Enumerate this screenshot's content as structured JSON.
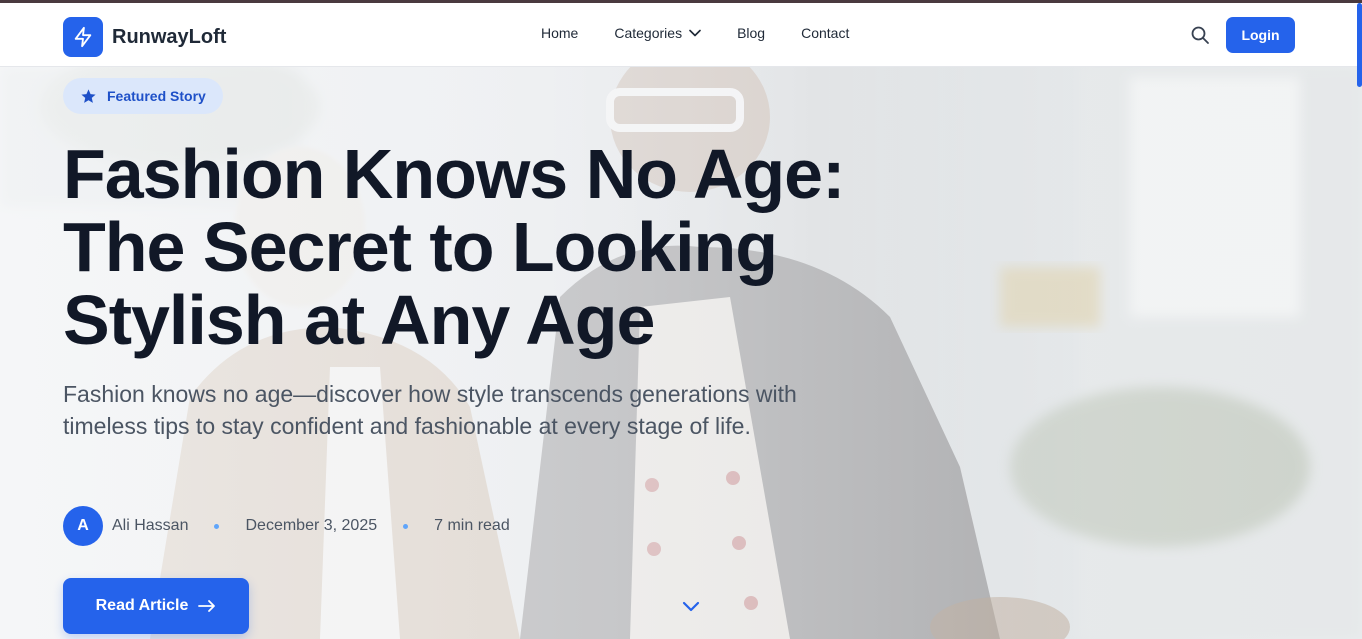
{
  "header": {
    "brand": "RunwayLoft",
    "nav": [
      {
        "label": "Home"
      },
      {
        "label": "Categories"
      },
      {
        "label": "Blog"
      },
      {
        "label": "Contact"
      }
    ],
    "login_label": "Login"
  },
  "hero": {
    "badge": "Featured Story",
    "headline_lines": [
      "Fashion Knows No Age:",
      "The Secret to Looking",
      "Stylish at Any Age"
    ],
    "subtitle": "Fashion knows no age—discover how style transcends generations with timeless tips to stay confident and fashionable at every stage of life.",
    "author_initial": "A",
    "author": "Ali Hassan",
    "date": "December 3, 2025",
    "read_time": "7 min read",
    "cta_label": "Read Article"
  },
  "colors": {
    "accent": "#2563eb",
    "badge_bg": "#dbe7fb",
    "headline": "#111827",
    "body_text": "#4b5563"
  },
  "icons": {
    "brand": "lightning-bolt-icon",
    "categories": "chevron-down-icon",
    "search": "search-icon",
    "badge": "star-icon",
    "cta": "arrow-right-icon",
    "scroll": "chevron-down-icon"
  }
}
